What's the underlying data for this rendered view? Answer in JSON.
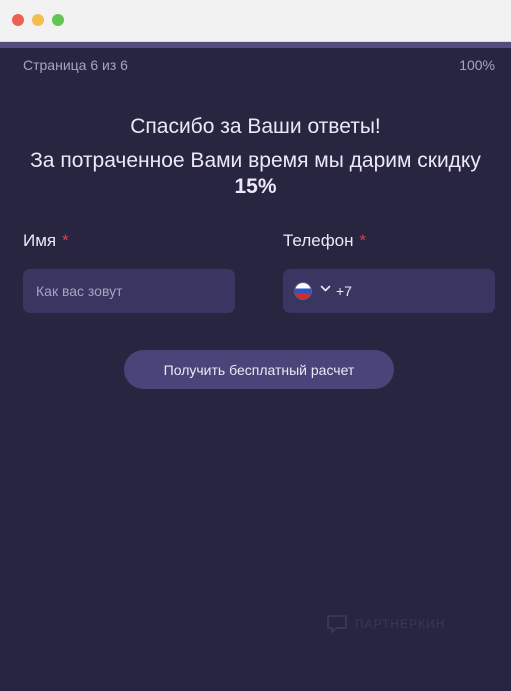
{
  "progress": {
    "page_label": "Страница 6 из 6",
    "percent_label": "100%",
    "fraction": 1.0
  },
  "heading": {
    "title": "Спасибо за Ваши ответы!",
    "subtitle_text": "За потраченное Вами время мы дарим скидку",
    "discount": "15%"
  },
  "form": {
    "name": {
      "label": "Имя",
      "required_mark": "*",
      "placeholder": "Как вас зовут"
    },
    "phone": {
      "label": "Телефон",
      "required_mark": "*",
      "country_flag": "russia-flag-icon",
      "value": "+7"
    },
    "submit_label": "Получить бесплатный расчет"
  },
  "watermark": {
    "text": "ПАРТНЕРКИН"
  },
  "colors": {
    "background": "#282541",
    "input_background": "#3a3662",
    "button_background": "#4a4578",
    "required": "#e23c43",
    "text": "#ebe9f7",
    "muted_text": "#a7a4c2"
  }
}
